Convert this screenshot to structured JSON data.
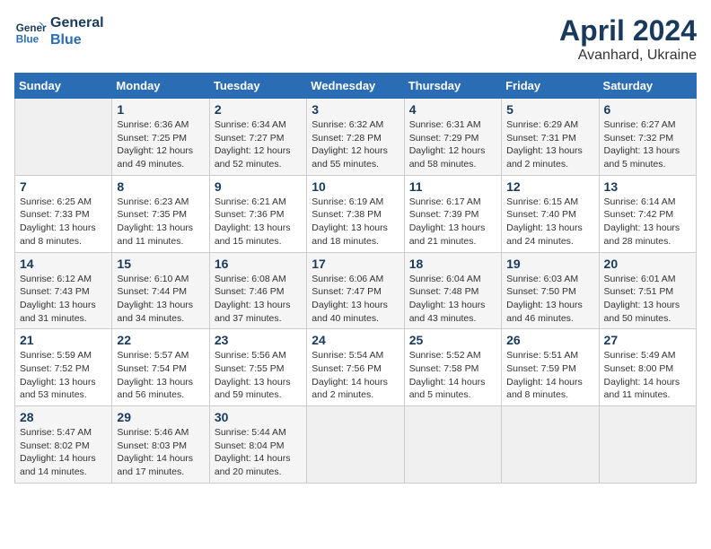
{
  "header": {
    "logo_line1": "General",
    "logo_line2": "Blue",
    "month": "April 2024",
    "location": "Avanhard, Ukraine"
  },
  "weekdays": [
    "Sunday",
    "Monday",
    "Tuesday",
    "Wednesday",
    "Thursday",
    "Friday",
    "Saturday"
  ],
  "weeks": [
    [
      {
        "day": "",
        "info": ""
      },
      {
        "day": "1",
        "info": "Sunrise: 6:36 AM\nSunset: 7:25 PM\nDaylight: 12 hours\nand 49 minutes."
      },
      {
        "day": "2",
        "info": "Sunrise: 6:34 AM\nSunset: 7:27 PM\nDaylight: 12 hours\nand 52 minutes."
      },
      {
        "day": "3",
        "info": "Sunrise: 6:32 AM\nSunset: 7:28 PM\nDaylight: 12 hours\nand 55 minutes."
      },
      {
        "day": "4",
        "info": "Sunrise: 6:31 AM\nSunset: 7:29 PM\nDaylight: 12 hours\nand 58 minutes."
      },
      {
        "day": "5",
        "info": "Sunrise: 6:29 AM\nSunset: 7:31 PM\nDaylight: 13 hours\nand 2 minutes."
      },
      {
        "day": "6",
        "info": "Sunrise: 6:27 AM\nSunset: 7:32 PM\nDaylight: 13 hours\nand 5 minutes."
      }
    ],
    [
      {
        "day": "7",
        "info": "Sunrise: 6:25 AM\nSunset: 7:33 PM\nDaylight: 13 hours\nand 8 minutes."
      },
      {
        "day": "8",
        "info": "Sunrise: 6:23 AM\nSunset: 7:35 PM\nDaylight: 13 hours\nand 11 minutes."
      },
      {
        "day": "9",
        "info": "Sunrise: 6:21 AM\nSunset: 7:36 PM\nDaylight: 13 hours\nand 15 minutes."
      },
      {
        "day": "10",
        "info": "Sunrise: 6:19 AM\nSunset: 7:38 PM\nDaylight: 13 hours\nand 18 minutes."
      },
      {
        "day": "11",
        "info": "Sunrise: 6:17 AM\nSunset: 7:39 PM\nDaylight: 13 hours\nand 21 minutes."
      },
      {
        "day": "12",
        "info": "Sunrise: 6:15 AM\nSunset: 7:40 PM\nDaylight: 13 hours\nand 24 minutes."
      },
      {
        "day": "13",
        "info": "Sunrise: 6:14 AM\nSunset: 7:42 PM\nDaylight: 13 hours\nand 28 minutes."
      }
    ],
    [
      {
        "day": "14",
        "info": "Sunrise: 6:12 AM\nSunset: 7:43 PM\nDaylight: 13 hours\nand 31 minutes."
      },
      {
        "day": "15",
        "info": "Sunrise: 6:10 AM\nSunset: 7:44 PM\nDaylight: 13 hours\nand 34 minutes."
      },
      {
        "day": "16",
        "info": "Sunrise: 6:08 AM\nSunset: 7:46 PM\nDaylight: 13 hours\nand 37 minutes."
      },
      {
        "day": "17",
        "info": "Sunrise: 6:06 AM\nSunset: 7:47 PM\nDaylight: 13 hours\nand 40 minutes."
      },
      {
        "day": "18",
        "info": "Sunrise: 6:04 AM\nSunset: 7:48 PM\nDaylight: 13 hours\nand 43 minutes."
      },
      {
        "day": "19",
        "info": "Sunrise: 6:03 AM\nSunset: 7:50 PM\nDaylight: 13 hours\nand 46 minutes."
      },
      {
        "day": "20",
        "info": "Sunrise: 6:01 AM\nSunset: 7:51 PM\nDaylight: 13 hours\nand 50 minutes."
      }
    ],
    [
      {
        "day": "21",
        "info": "Sunrise: 5:59 AM\nSunset: 7:52 PM\nDaylight: 13 hours\nand 53 minutes."
      },
      {
        "day": "22",
        "info": "Sunrise: 5:57 AM\nSunset: 7:54 PM\nDaylight: 13 hours\nand 56 minutes."
      },
      {
        "day": "23",
        "info": "Sunrise: 5:56 AM\nSunset: 7:55 PM\nDaylight: 13 hours\nand 59 minutes."
      },
      {
        "day": "24",
        "info": "Sunrise: 5:54 AM\nSunset: 7:56 PM\nDaylight: 14 hours\nand 2 minutes."
      },
      {
        "day": "25",
        "info": "Sunrise: 5:52 AM\nSunset: 7:58 PM\nDaylight: 14 hours\nand 5 minutes."
      },
      {
        "day": "26",
        "info": "Sunrise: 5:51 AM\nSunset: 7:59 PM\nDaylight: 14 hours\nand 8 minutes."
      },
      {
        "day": "27",
        "info": "Sunrise: 5:49 AM\nSunset: 8:00 PM\nDaylight: 14 hours\nand 11 minutes."
      }
    ],
    [
      {
        "day": "28",
        "info": "Sunrise: 5:47 AM\nSunset: 8:02 PM\nDaylight: 14 hours\nand 14 minutes."
      },
      {
        "day": "29",
        "info": "Sunrise: 5:46 AM\nSunset: 8:03 PM\nDaylight: 14 hours\nand 17 minutes."
      },
      {
        "day": "30",
        "info": "Sunrise: 5:44 AM\nSunset: 8:04 PM\nDaylight: 14 hours\nand 20 minutes."
      },
      {
        "day": "",
        "info": ""
      },
      {
        "day": "",
        "info": ""
      },
      {
        "day": "",
        "info": ""
      },
      {
        "day": "",
        "info": ""
      }
    ]
  ]
}
